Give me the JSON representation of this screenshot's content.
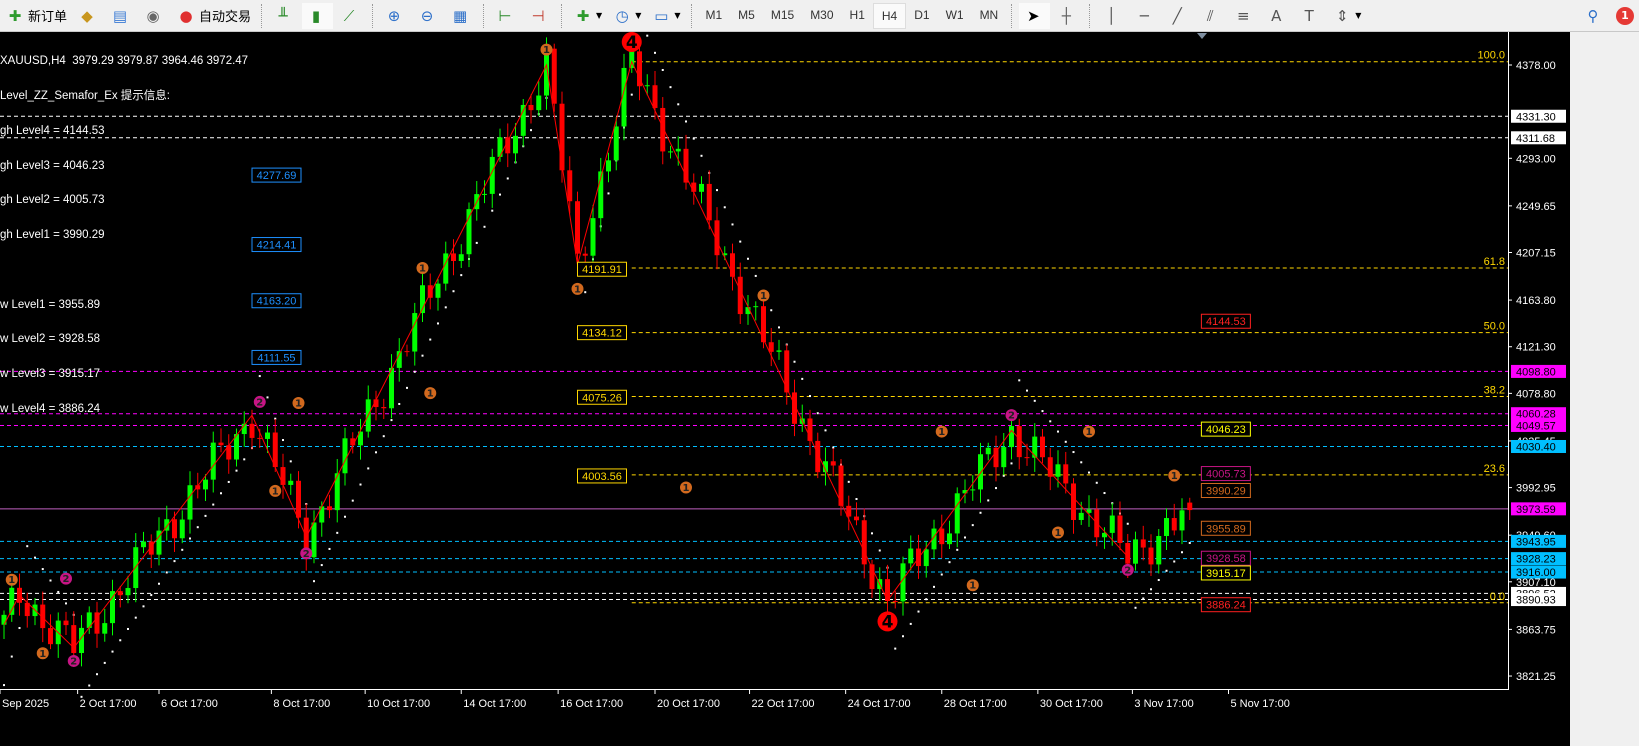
{
  "toolbar": {
    "new_order": "新订单",
    "auto_trading": "自动交易",
    "timeframes": [
      "M1",
      "M5",
      "M15",
      "M30",
      "H1",
      "H4",
      "D1",
      "W1",
      "MN"
    ],
    "active_timeframe": "H4",
    "notification_count": "1"
  },
  "info": {
    "header": "XAUUSD,H4  3979.29 3979.87 3964.46 3972.47",
    "indicator": "Level_ZZ_Semafor_Ex 提示信息:",
    "lines": [
      "gh Level4 = 4144.53",
      "gh Level3 = 4046.23",
      "gh Level2 = 4005.73",
      "gh Level1 = 3990.29",
      "",
      "w Level1 = 3955.89",
      "w Level2 = 3928.58",
      "w Level3 = 3915.17",
      "w Level4 = 3886.24"
    ]
  },
  "colors": {
    "bull": "#00ff00",
    "bear": "#ff0000",
    "zigzag": "#ff0000",
    "fib": "#ffd700",
    "sar": "#ffffff",
    "semafor1": "#d2691e",
    "semafor2": "#c71585",
    "semafor4": "#ff0000"
  },
  "chart_data": {
    "type": "candlestick",
    "symbol": "XAUUSD",
    "timeframe": "H4",
    "ylim": [
      3800,
      4420
    ],
    "bars": 154,
    "zigzag": [
      [
        0,
        3868
      ],
      [
        2,
        3895
      ],
      [
        9,
        3847
      ],
      [
        32,
        4059
      ],
      [
        39,
        3948
      ],
      [
        70,
        4378
      ],
      [
        74,
        4196
      ],
      [
        81,
        4381
      ],
      [
        114,
        3890
      ],
      [
        130,
        4045
      ],
      [
        145,
        3930
      ],
      [
        153,
        3972.47
      ]
    ],
    "y_ticks": [
      "4378.00",
      "4293.00",
      "4249.65",
      "4207.15",
      "4163.80",
      "4121.30",
      "4078.80",
      "4035.45",
      "3992.95",
      "3949.60",
      "3907.10",
      "3863.75",
      "3821.25"
    ],
    "x_ticks": [
      {
        "bar": -1,
        "label": "Sep 2025"
      },
      {
        "bar": 9.5,
        "label": "2 Oct 17:00"
      },
      {
        "bar": 20,
        "label": "6 Oct 17:00"
      },
      {
        "bar": 34.5,
        "label": "8 Oct 17:00"
      },
      {
        "bar": 46.6,
        "label": "10 Oct 17:00"
      },
      {
        "bar": 59,
        "label": "14 Oct 17:00"
      },
      {
        "bar": 71.5,
        "label": "16 Oct 17:00"
      },
      {
        "bar": 84,
        "label": "20 Oct 17:00"
      },
      {
        "bar": 96.2,
        "label": "22 Oct 17:00"
      },
      {
        "bar": 108.6,
        "label": "24 Oct 17:00"
      },
      {
        "bar": 121,
        "label": "28 Oct 17:00"
      },
      {
        "bar": 133.4,
        "label": "30 Oct 17:00"
      },
      {
        "bar": 145.6,
        "label": "3 Nov 17:00"
      },
      {
        "bar": 158,
        "label": "5 Nov 17:00"
      }
    ],
    "h_lines": [
      {
        "price": 4331.3,
        "color": "#ffffff",
        "label": "4331.30",
        "tag_bg": "#ffffff",
        "tag_fg": "#000000"
      },
      {
        "price": 4311.68,
        "color": "#ffffff",
        "label": "4311.68",
        "tag_bg": "#ffffff",
        "tag_fg": "#000000"
      },
      {
        "price": 4098.8,
        "color": "#ff00ff",
        "label": "4098.80",
        "tag_bg": "#ff00ff",
        "tag_fg": "#000000"
      },
      {
        "price": 4060.28,
        "color": "#ff00ff",
        "label": "4060.28",
        "tag_bg": "#ff00ff",
        "tag_fg": "#000000"
      },
      {
        "price": 4049.57,
        "color": "#ff00ff",
        "label": "4049.57",
        "tag_bg": "#ff00ff",
        "tag_fg": "#000000"
      },
      {
        "price": 4030.4,
        "color": "#00bfff",
        "label": "4030.40",
        "tag_bg": "#00bfff",
        "tag_fg": "#000000"
      },
      {
        "price": 3973.59,
        "color": "#c060c0",
        "label": "3973.59",
        "tag_bg": "#ff00ff",
        "tag_fg": "#000000",
        "solid": true
      },
      {
        "price": 3943.95,
        "color": "#00bfff",
        "label": "3943.95",
        "tag_bg": "#00bfff",
        "tag_fg": "#000000"
      },
      {
        "price": 3928.23,
        "color": "#00bfff",
        "label": "3928.23",
        "tag_bg": "#00bfff",
        "tag_fg": "#000000"
      },
      {
        "price": 3916.0,
        "color": "#00bfff",
        "label": "3916.00",
        "tag_bg": "#00bfff",
        "tag_fg": "#000000"
      },
      {
        "price": 3896.52,
        "color": "#ffffff",
        "label": "3896.52",
        "tag_bg": "#ffffff",
        "tag_fg": "#000000"
      },
      {
        "price": 3890.93,
        "color": "#ffffff",
        "label": "3890.93",
        "tag_bg": "#ffffff",
        "tag_fg": "#000000"
      }
    ],
    "fibonacci": {
      "start_bar": 81,
      "levels": [
        {
          "label": "100.0",
          "price": 4381.0
        },
        {
          "label": "61.8",
          "price": 4193.0
        },
        {
          "label": "50.0",
          "price": 4134.1
        },
        {
          "label": "38.2",
          "price": 4076.0
        },
        {
          "label": "23.6",
          "price": 4004.5
        },
        {
          "label": "0.0",
          "price": 3888.0
        }
      ]
    },
    "level_boxes": [
      {
        "bar": 32,
        "price": 4277.69,
        "text": "4277.69",
        "color": "#1e90ff"
      },
      {
        "bar": 32,
        "price": 4214.41,
        "text": "4214.41",
        "color": "#1e90ff"
      },
      {
        "bar": 32,
        "price": 4163.2,
        "text": "4163.20",
        "color": "#1e90ff"
      },
      {
        "bar": 32,
        "price": 4111.55,
        "text": "4111.55",
        "color": "#1e90ff"
      },
      {
        "bar": 74,
        "price": 4191.91,
        "text": "4191.91",
        "color": "#ffd700"
      },
      {
        "bar": 74,
        "price": 4134.12,
        "text": "4134.12",
        "color": "#ffd700"
      },
      {
        "bar": 74,
        "price": 4075.26,
        "text": "4075.26",
        "color": "#ffd700"
      },
      {
        "bar": 74,
        "price": 4003.56,
        "text": "4003.56",
        "color": "#ffd700"
      },
      {
        "bar": 154.5,
        "price": 4144.53,
        "text": "4144.53",
        "color": "#ff2020"
      },
      {
        "bar": 154.5,
        "price": 4046.23,
        "text": "4046.23",
        "color": "#ffff00"
      },
      {
        "bar": 154.5,
        "price": 4005.73,
        "text": "4005.73",
        "color": "#c71585"
      },
      {
        "bar": 154.5,
        "price": 3990.29,
        "text": "3990.29",
        "color": "#d2691e"
      },
      {
        "bar": 154.5,
        "price": 3955.89,
        "text": "3955.89",
        "color": "#d2691e"
      },
      {
        "bar": 154.5,
        "price": 3928.58,
        "text": "3928.58",
        "color": "#c71585"
      },
      {
        "bar": 154.5,
        "price": 3915.17,
        "text": "3915.17",
        "color": "#ffff00"
      },
      {
        "bar": 154.5,
        "price": 3886.24,
        "text": "3886.24",
        "color": "#ff2020"
      }
    ],
    "semafor": [
      {
        "bar": 1,
        "price": 3909,
        "label": "1"
      },
      {
        "bar": 8,
        "price": 3910,
        "label": "2"
      },
      {
        "bar": 5,
        "price": 3842,
        "label": "1"
      },
      {
        "bar": 9,
        "price": 3835,
        "label": "2"
      },
      {
        "bar": 33,
        "price": 4071,
        "label": "2"
      },
      {
        "bar": 38,
        "price": 4070,
        "label": "1"
      },
      {
        "bar": 35,
        "price": 3990,
        "label": "1"
      },
      {
        "bar": 39,
        "price": 3933,
        "label": "2"
      },
      {
        "bar": 54,
        "price": 4193,
        "label": "1"
      },
      {
        "bar": 55,
        "price": 4079,
        "label": "1"
      },
      {
        "bar": 70,
        "price": 4392,
        "label": "1"
      },
      {
        "bar": 74,
        "price": 4174,
        "label": "1"
      },
      {
        "bar": 81,
        "price": 4399,
        "label": "4"
      },
      {
        "bar": 88,
        "price": 3993,
        "label": "1"
      },
      {
        "bar": 98,
        "price": 4168,
        "label": "1"
      },
      {
        "bar": 114,
        "price": 3871,
        "label": "4"
      },
      {
        "bar": 121,
        "price": 4044,
        "label": "1"
      },
      {
        "bar": 130,
        "price": 4059,
        "label": "2"
      },
      {
        "bar": 125,
        "price": 3904,
        "label": "1"
      },
      {
        "bar": 136,
        "price": 3952,
        "label": "1"
      },
      {
        "bar": 140,
        "price": 4044,
        "label": "1"
      },
      {
        "bar": 145,
        "price": 3918,
        "label": "2"
      },
      {
        "bar": 151,
        "price": 4004,
        "label": "1"
      }
    ],
    "last": {
      "open": 3979.29,
      "high": 3979.87,
      "low": 3964.46,
      "close": 3972.47
    }
  }
}
